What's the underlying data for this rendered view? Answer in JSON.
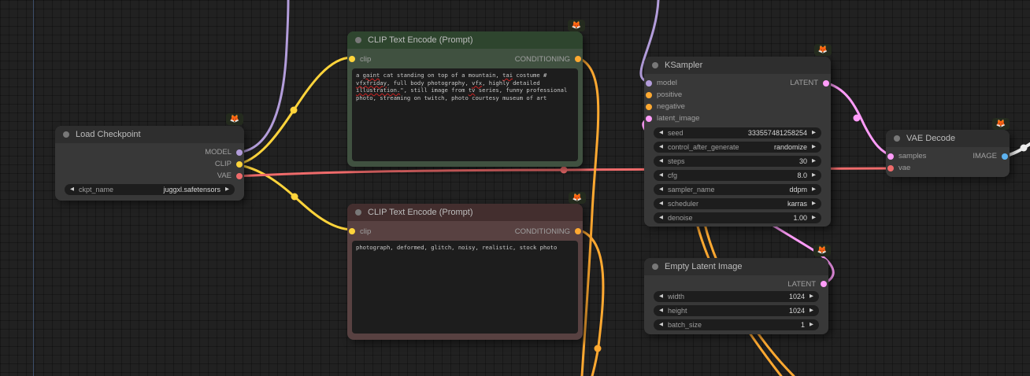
{
  "app": {
    "name": "ComfyUI node graph"
  },
  "badge_icon": "🦊",
  "colors": {
    "canvas_bg": "#212121",
    "axis_line": "#3c4d68",
    "node_default_body": "#383838",
    "node_default_header": "#2e2e2e",
    "node_green_body": "#405140",
    "node_green_header": "#2e452e",
    "node_red_body": "#584141",
    "node_red_header": "#432e2e",
    "port_model": "#b39ddb",
    "port_clip": "#ffd43b",
    "port_vae": "#ef6b6b",
    "port_conditioning": "#ffa931",
    "port_latent": "#ff9cf9",
    "port_image": "#5db2f0",
    "wire_image": "#ececec"
  },
  "nodes": {
    "load_checkpoint": {
      "title": "Load Checkpoint",
      "outputs": [
        "MODEL",
        "CLIP",
        "VAE"
      ],
      "widgets": [
        {
          "label": "ckpt_name",
          "value": "juggxl.safetensors"
        }
      ]
    },
    "clip_positive": {
      "title": "CLIP Text Encode (Prompt)",
      "inputs": [
        "clip"
      ],
      "outputs": [
        "CONDITIONING"
      ],
      "prompt_lines": [
        [
          {
            "t": "a "
          },
          {
            "t": "gaint",
            "m": 1
          },
          {
            "t": " cat standing on top of a mountain, "
          },
          {
            "t": "tai",
            "m": 1
          },
          {
            "t": " costume #"
          }
        ],
        [
          {
            "t": "vfxfriday",
            "m": 1
          },
          {
            "t": ", full body photography, "
          },
          {
            "t": "vfx",
            "m": 1
          },
          {
            "t": ", highly detailed"
          }
        ],
        [
          {
            "t": "illustration.",
            "m": 1
          },
          {
            "t": "\", still image from "
          },
          {
            "t": "tv",
            "m": 1
          },
          {
            "t": " series, funny professional"
          }
        ],
        [
          {
            "t": "photo, streaming on twitch, photo courtesy museum of art"
          }
        ]
      ]
    },
    "clip_negative": {
      "title": "CLIP Text Encode (Prompt)",
      "inputs": [
        "clip"
      ],
      "outputs": [
        "CONDITIONING"
      ],
      "prompt": "photograph, deformed, glitch, noisy, realistic, stock photo"
    },
    "ksampler": {
      "title": "KSampler",
      "inputs": [
        "model",
        "positive",
        "negative",
        "latent_image"
      ],
      "outputs": [
        "LATENT"
      ],
      "widgets": [
        {
          "label": "seed",
          "value": "333557481258254"
        },
        {
          "label": "control_after_generate",
          "value": "randomize"
        },
        {
          "label": "steps",
          "value": "30"
        },
        {
          "label": "cfg",
          "value": "8.0"
        },
        {
          "label": "sampler_name",
          "value": "ddpm"
        },
        {
          "label": "scheduler",
          "value": "karras"
        },
        {
          "label": "denoise",
          "value": "1.00"
        }
      ]
    },
    "empty_latent": {
      "title": "Empty Latent Image",
      "outputs": [
        "LATENT"
      ],
      "widgets": [
        {
          "label": "width",
          "value": "1024"
        },
        {
          "label": "height",
          "value": "1024"
        },
        {
          "label": "batch_size",
          "value": "1"
        }
      ]
    },
    "vae_decode": {
      "title": "VAE Decode",
      "inputs": [
        "samples",
        "vae"
      ],
      "outputs": [
        "IMAGE"
      ]
    }
  },
  "ui": {
    "arrow_left": "◀",
    "arrow_right": "▶"
  }
}
